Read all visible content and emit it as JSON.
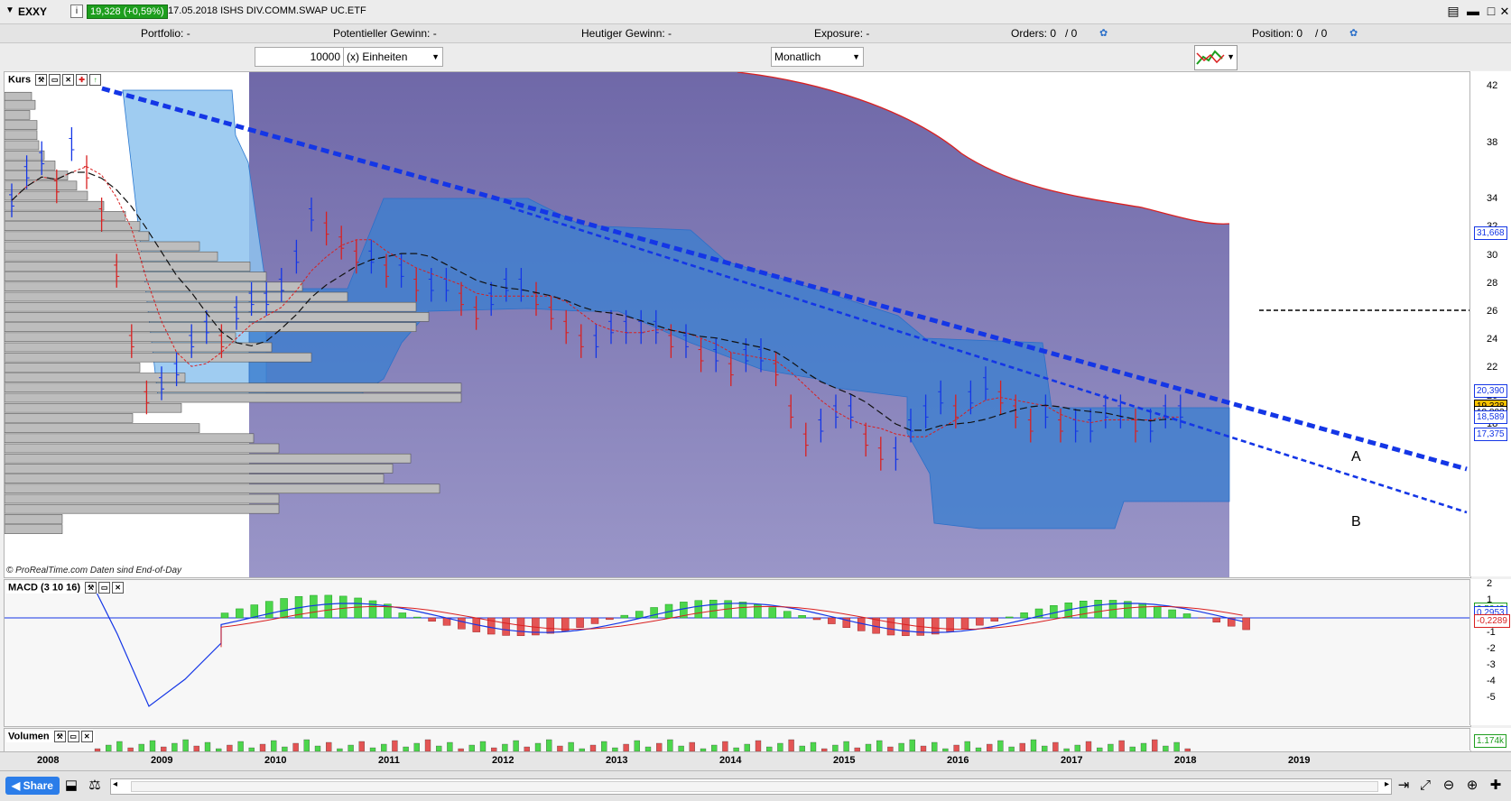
{
  "topbar": {
    "symbol": "EXXY",
    "info_glyph": "i",
    "price_badge": "19,328 (+0,59%)",
    "title": "17.05.2018 ISHS DIV.COMM.SWAP UC.ETF",
    "icons": [
      "menu-icon",
      "minimize-icon",
      "maximize-icon",
      "close-icon"
    ]
  },
  "info_row": {
    "portfolio_label": "Portfolio: -",
    "potential_gain_label": "Potentieller Gewinn: -",
    "today_gain_label": "Heutiger Gewinn: -",
    "exposure_label": "Exposure: -",
    "orders_label": "Orders: 0",
    "orders_sep": "/ 0",
    "position_label": "Position: 0",
    "position_sep": "/ 0"
  },
  "controls": {
    "quantity_value": "10000",
    "unit_select": "(x) Einheiten",
    "period_select": "Monatlich"
  },
  "price_pane": {
    "label": "Kurs",
    "footer_text": "© ProRealTime.com  Daten sind End-of-Day",
    "annotation_a": "A",
    "annotation_b": "B",
    "y_ticks": [
      "42",
      "38",
      "34",
      "32",
      "30",
      "28",
      "26",
      "24",
      "22",
      "20",
      "18"
    ],
    "price_labels": [
      "31,668",
      "20,390",
      "19,328",
      "18,883",
      "18,589",
      "17,375"
    ],
    "accent_colors": {
      "blue_trend": "#1436e6",
      "upper_band": "#d92020",
      "cloud": "#3b7fd0",
      "cloud_light": "#8ec3ef",
      "background": "#7c78b4"
    }
  },
  "macd_pane": {
    "label": "MACD (3 10 16)",
    "y_ticks": [
      "2",
      "1",
      "0",
      "-1",
      "-2",
      "-3",
      "-4",
      "-5"
    ],
    "value_labels": [
      "0,5242",
      "0,2953",
      "-0,2289"
    ]
  },
  "volume_pane": {
    "label": "Volumen",
    "value_label": "1.174k"
  },
  "x_axis": {
    "years": [
      "2008",
      "2009",
      "2010",
      "2011",
      "2012",
      "2013",
      "2014",
      "2015",
      "2016",
      "2017",
      "2018",
      "2019"
    ]
  },
  "bottombar": {
    "share_label": "Share",
    "icons": [
      "layout-icon",
      "scale-icon",
      "scroll-left-icon",
      "scroll-right-icon",
      "zoom-icon",
      "zoom-in-icon",
      "zoom-out-icon",
      "crosshair-icon"
    ]
  }
}
